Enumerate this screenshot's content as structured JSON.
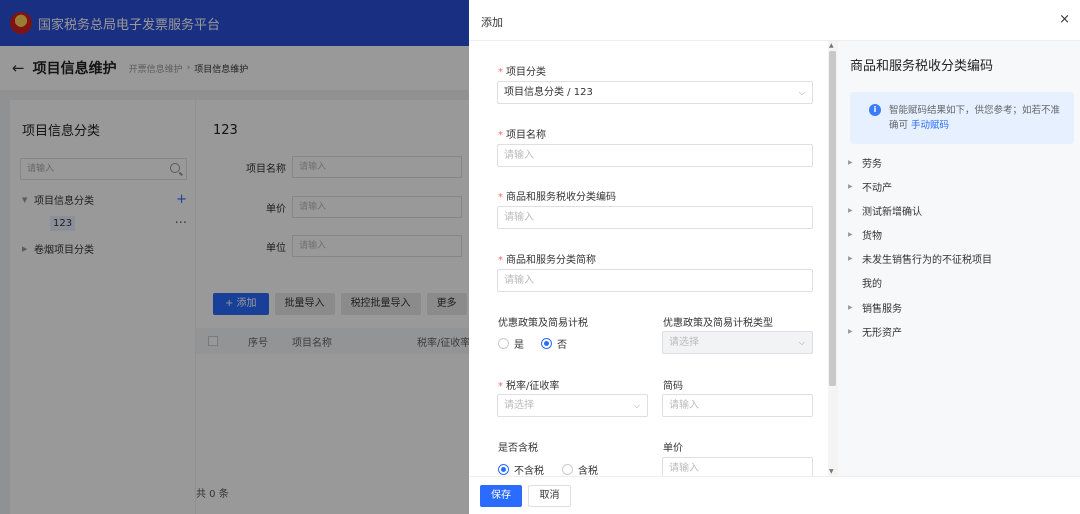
{
  "app": {
    "title": "国家税务总局电子发票服务平台"
  },
  "header": {
    "page_title": "项目信息维护",
    "breadcrumb": [
      "开票信息维护",
      "项目信息维护"
    ]
  },
  "left_panel": {
    "title": "项目信息分类",
    "search_placeholder": "请输入",
    "tree": [
      {
        "label": "项目信息分类",
        "action": "+"
      },
      {
        "label": "123",
        "action": "···"
      },
      {
        "label": "卷烟项目分类"
      }
    ]
  },
  "right_panel": {
    "title": "123",
    "fields": [
      {
        "label": "项目名称",
        "placeholder": "请输入"
      },
      {
        "label": "单价",
        "placeholder": "请输入"
      },
      {
        "label": "单位",
        "placeholder": "请输入"
      }
    ],
    "buttons": {
      "add": "+ 添加",
      "batch_import": "批量导入",
      "tax_batch_import": "税控批量导入",
      "more": "更多"
    },
    "table_columns": [
      "序号",
      "项目名称",
      "税率/征收率"
    ],
    "total": "共 0 条"
  },
  "drawer": {
    "title": "添加",
    "close": "×",
    "form": {
      "category_label": "项目分类",
      "category_value": "项目信息分类 / 123",
      "name_label": "项目名称",
      "name_placeholder": "请输入",
      "tax_code_label": "商品和服务税收分类编码",
      "tax_code_placeholder": "请输入",
      "short_name_label": "商品和服务分类简称",
      "short_name_placeholder": "请输入",
      "preferential_label": "优惠政策及简易计税",
      "preferential_options": [
        "是",
        "否"
      ],
      "preferential_type_label": "优惠政策及简易计税类型",
      "preferential_type_placeholder": "请选择",
      "tax_rate_label": "税率/征收率",
      "tax_rate_placeholder": "请选择",
      "code_label": "简码",
      "code_placeholder": "请输入",
      "tax_included_label": "是否含税",
      "tax_included_options": [
        "不含税",
        "含税"
      ],
      "price_label": "单价",
      "price_placeholder": "请输入"
    },
    "side": {
      "title": "商品和服务税收分类编码",
      "tip_text": "智能赋码结果如下，供您参考；如若不准确可",
      "tip_link": "手动赋码",
      "categories": [
        "劳务",
        "不动产",
        "测试新增确认",
        "货物",
        "未发生销售行为的不征税项目",
        "我的",
        "销售服务",
        "无形资产"
      ]
    },
    "footer": {
      "save": "保存",
      "cancel": "取消"
    }
  }
}
